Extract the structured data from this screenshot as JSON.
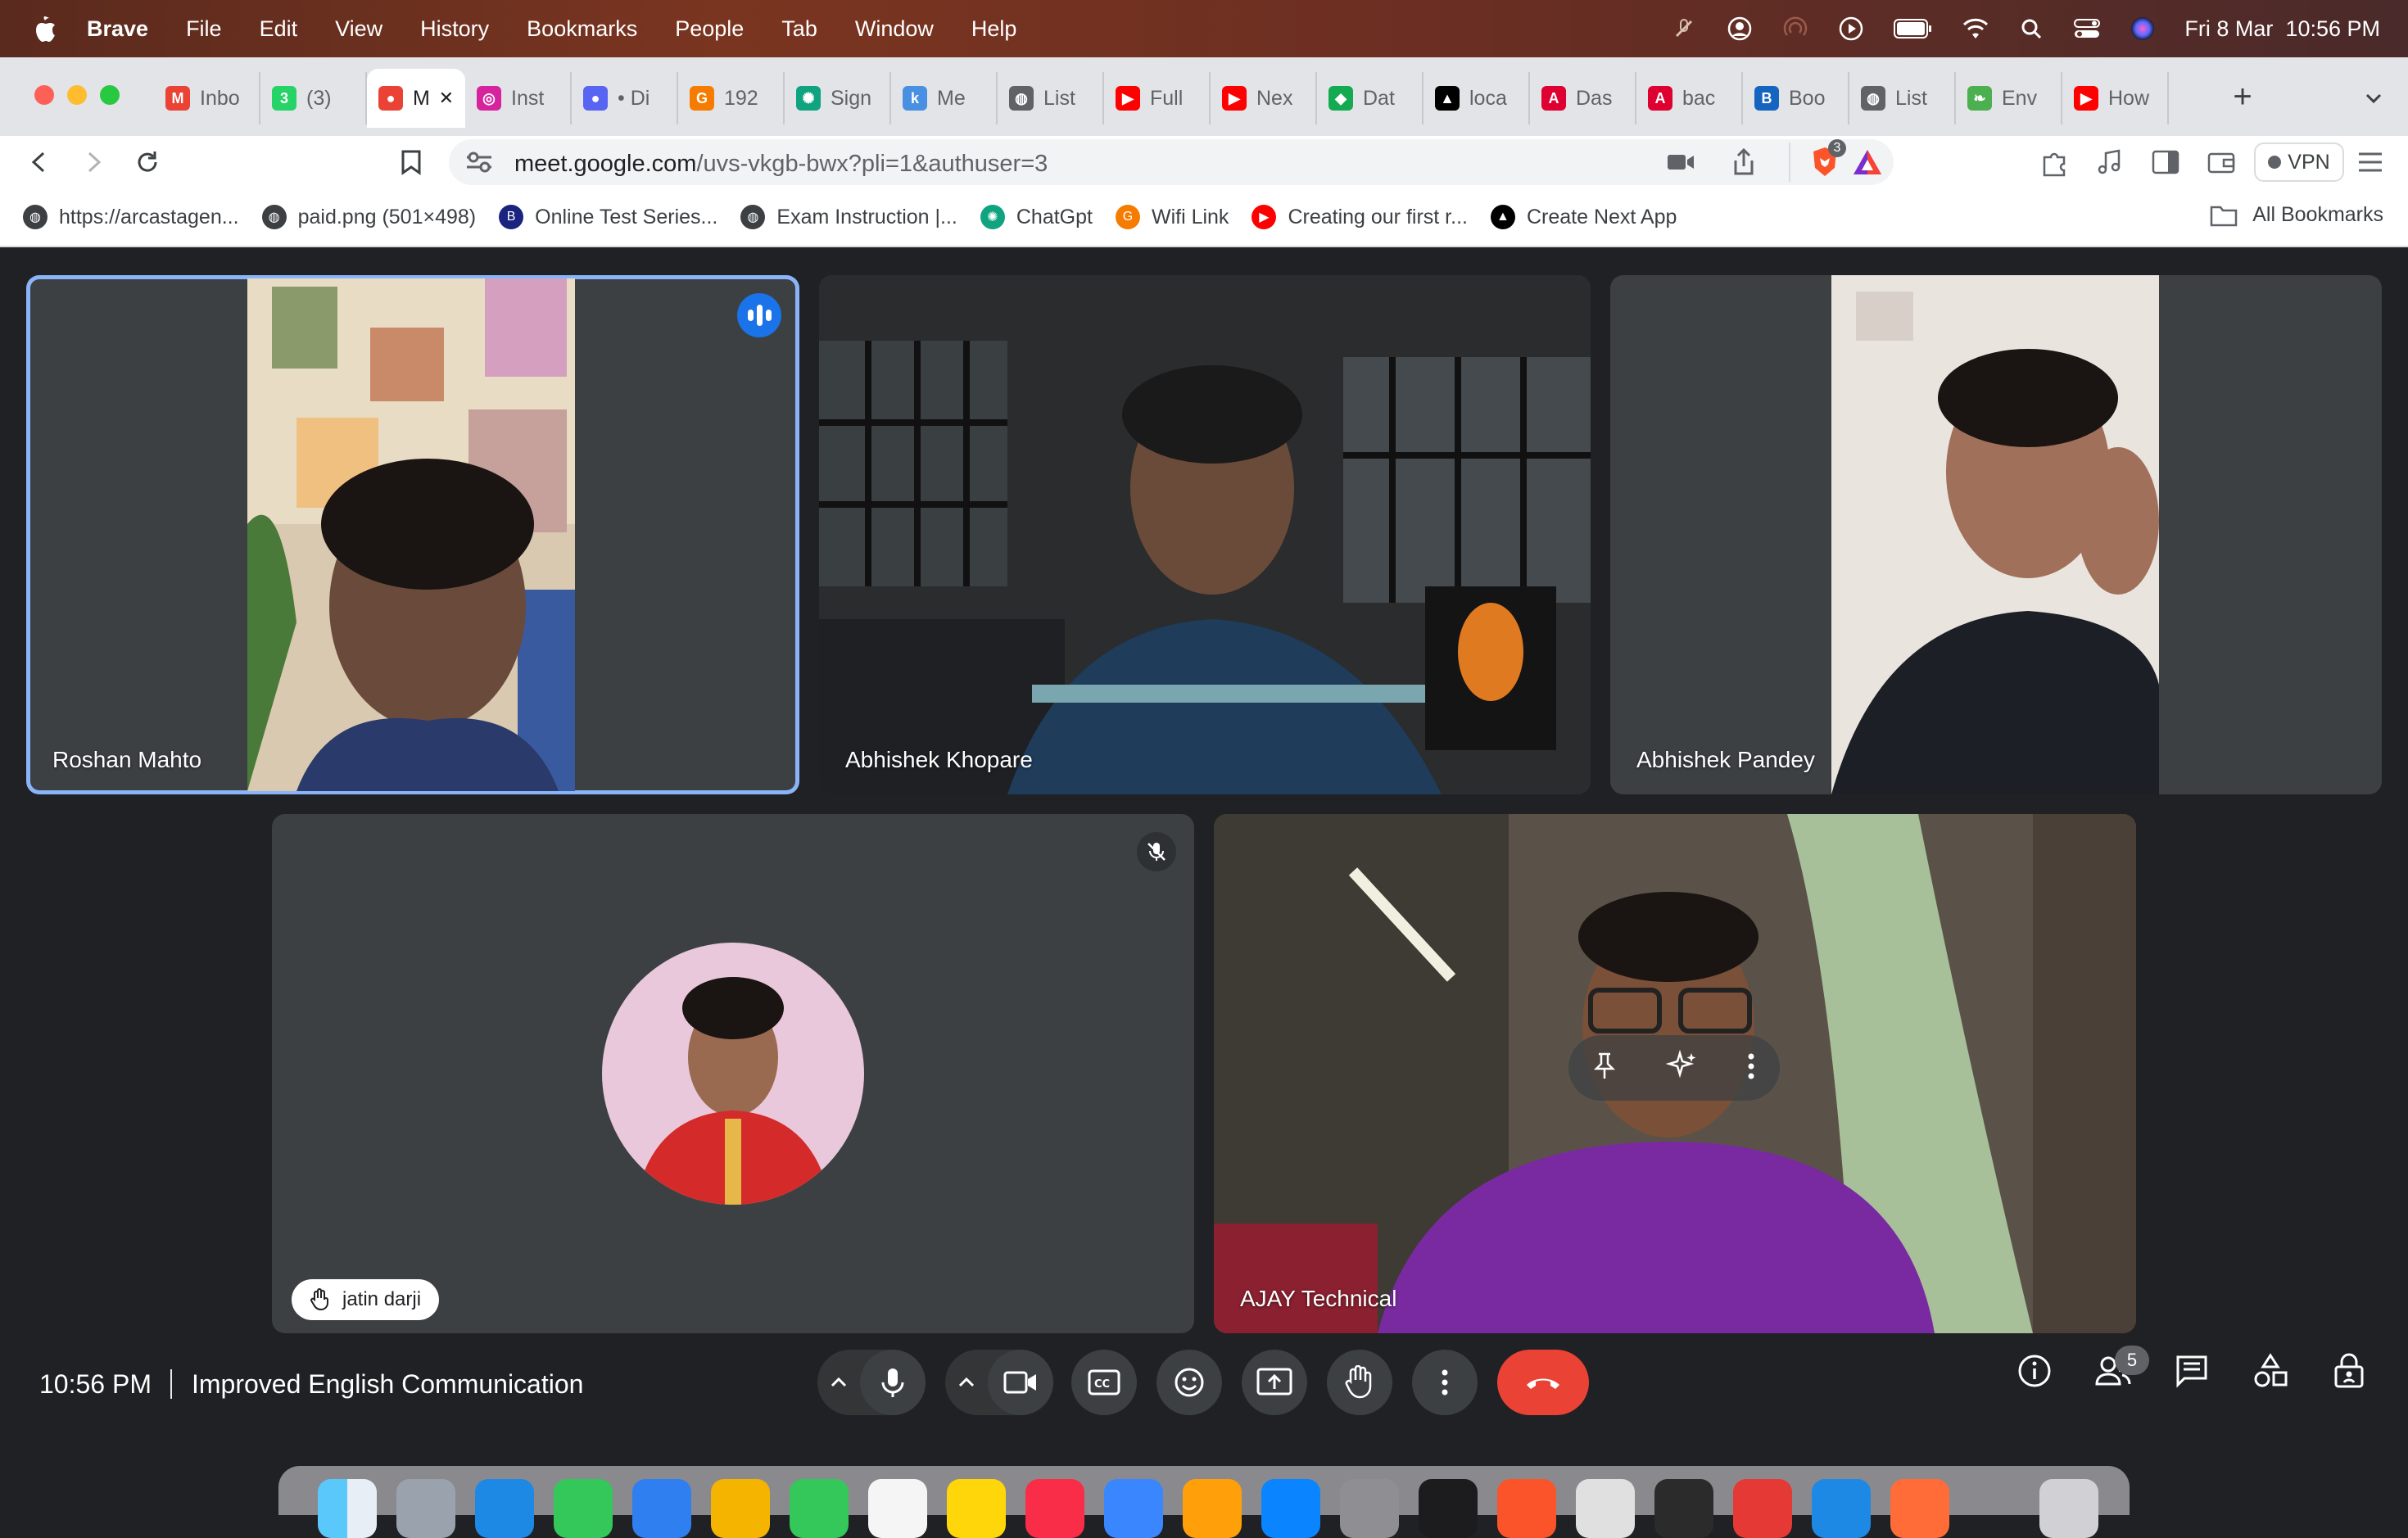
{
  "menubar": {
    "app_name": "Brave",
    "menus": [
      "File",
      "Edit",
      "View",
      "History",
      "Bookmarks",
      "People",
      "Tab",
      "Window",
      "Help"
    ],
    "datetime": "Fri 8 Mar  10:56 PM"
  },
  "tabs": [
    {
      "title": "Inbo",
      "icon": "gmail-icon",
      "color": "#ea4335"
    },
    {
      "title": "(3)",
      "icon": "whatsapp-icon",
      "color": "#25d366"
    },
    {
      "title": "M",
      "icon": "meet-recording-icon",
      "color": "#ea4335",
      "active": true
    },
    {
      "title": "Inst",
      "icon": "instagram-icon",
      "color": "#d6249f"
    },
    {
      "title": "• Di",
      "icon": "discord-icon",
      "color": "#5865f2"
    },
    {
      "title": "192",
      "icon": "router-icon",
      "color": "#f57c00"
    },
    {
      "title": "Sign",
      "icon": "openai-icon",
      "color": "#10a37f"
    },
    {
      "title": "Me",
      "icon": "k-icon",
      "color": "#4a90e2"
    },
    {
      "title": "List",
      "icon": "globe-icon",
      "color": "#5f6368"
    },
    {
      "title": "Full",
      "icon": "youtube-icon",
      "color": "#ff0000"
    },
    {
      "title": "Nex",
      "icon": "youtube-icon",
      "color": "#ff0000"
    },
    {
      "title": "Dat",
      "icon": "mongodb-icon",
      "color": "#13aa52"
    },
    {
      "title": "loca",
      "icon": "nextjs-icon",
      "color": "#000000"
    },
    {
      "title": "Das",
      "icon": "angular-icon",
      "color": "#dd0031"
    },
    {
      "title": "bac",
      "icon": "angular-icon",
      "color": "#dd0031"
    },
    {
      "title": "Boo",
      "icon": "book-icon",
      "color": "#1565c0"
    },
    {
      "title": "List",
      "icon": "globe-icon",
      "color": "#5f6368"
    },
    {
      "title": "Env",
      "icon": "leaf-icon",
      "color": "#4caf50"
    },
    {
      "title": "How",
      "icon": "youtube-icon",
      "color": "#ff0000"
    }
  ],
  "toolbar": {
    "url_host": "meet.google.com",
    "url_path": "/uvs-vkgb-bwx?pli=1&authuser=3",
    "shield_count": "3",
    "vpn_label": "VPN"
  },
  "bookmarks": [
    {
      "label": "https://arcastagen...",
      "icon": "globe-icon",
      "color": "#3c4043"
    },
    {
      "label": "paid.png (501×498)",
      "icon": "globe-icon",
      "color": "#3c4043"
    },
    {
      "label": "Online Test Series...",
      "icon": "book-icon",
      "color": "#1a237e"
    },
    {
      "label": "Exam Instruction |...",
      "icon": "globe-icon",
      "color": "#3c4043"
    },
    {
      "label": "ChatGpt",
      "icon": "openai-icon",
      "color": "#10a37f"
    },
    {
      "label": "Wifi Link",
      "icon": "router-icon",
      "color": "#f57c00"
    },
    {
      "label": "Creating our first r...",
      "icon": "youtube-icon",
      "color": "#ff0000"
    },
    {
      "label": "Create Next App",
      "icon": "nextjs-icon",
      "color": "#000000"
    }
  ],
  "all_bookmarks": "All Bookmarks",
  "participants": {
    "p1": "Roshan Mahto",
    "p2": "Abhishek Khopare",
    "p3": "Abhishek Pandey",
    "p4": "jatin darji",
    "p5": "AJAY Technical"
  },
  "controls": {
    "time": "10:56 PM",
    "meeting_name": "Improved English Communication",
    "people_count": "5"
  },
  "colors": {
    "meet_bg": "#202124",
    "tile_bg": "#3c4043",
    "speaking_border": "#8ab4f8",
    "end_call": "#ea4335"
  }
}
